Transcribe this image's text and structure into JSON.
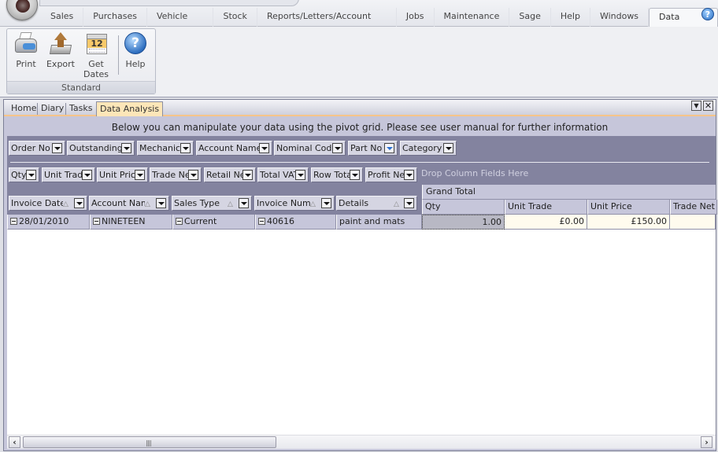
{
  "ribbon_tabs": [
    {
      "label": "Sales"
    },
    {
      "label": "Purchases"
    },
    {
      "label": "Vehicle Sales"
    },
    {
      "label": "Stock"
    },
    {
      "label": "Reports/Letters/Account Manager"
    },
    {
      "label": "Jobs"
    },
    {
      "label": "Maintenance"
    },
    {
      "label": "Sage"
    },
    {
      "label": "Help"
    },
    {
      "label": "Windows"
    },
    {
      "label": "Data Analysis",
      "active": true
    }
  ],
  "ribbon_help_glyph": "?",
  "ribbon_group": {
    "label": "Standard",
    "buttons": [
      {
        "label": "Print",
        "icon": "printer-icon"
      },
      {
        "label": "Export",
        "icon": "export-icon"
      },
      {
        "label": "Get\nDates",
        "line1": "Get",
        "line2": "Dates",
        "icon": "calendar-icon",
        "calendar_day": "12"
      },
      {
        "label": "Help",
        "icon": "help-icon",
        "glyph": "?"
      }
    ]
  },
  "document_tabs": [
    {
      "label": "Home"
    },
    {
      "label": "Diary"
    },
    {
      "label": "Tasks"
    },
    {
      "label": "Data Analysis",
      "active": true
    }
  ],
  "window_controls": {
    "menu_glyph": "▼",
    "close_glyph": "✕"
  },
  "intro_text": "Below you can manipulate your data using the pivot grid.  Please see user manual for further information",
  "pivot": {
    "filter_fields": [
      "Order No",
      "Outstanding",
      "Mechanic",
      "Account Name",
      "Nominal Code",
      "Part No",
      "Category"
    ],
    "data_fields": [
      "Qty",
      "Unit Trade",
      "Unit Price",
      "Trade Net",
      "Retail Net",
      "Total VAT",
      "Row Total",
      "Profit Net"
    ],
    "drop_column_hint": "Drop Column Fields Here",
    "row_fields": [
      "Invoice Date",
      "Account Name",
      "Sales Type",
      "Invoice Number",
      "Details"
    ],
    "sort_glyph": "△",
    "grand_total_label": "Grand Total",
    "column_headers": [
      "Qty",
      "Unit Trade",
      "Unit Price",
      "Trade Net"
    ],
    "rows": [
      {
        "invoice_date": "28/01/2010",
        "account_name": "NINETEEN",
        "sales_type": "Current",
        "invoice_number": "40616",
        "details": "paint and mats",
        "qty": "1.00",
        "unit_trade": "£0.00",
        "unit_price": "£150.00",
        "trade_net": ""
      }
    ]
  },
  "scrollbar": {
    "left_glyph": "‹",
    "right_glyph": "›",
    "grip": "||||"
  }
}
